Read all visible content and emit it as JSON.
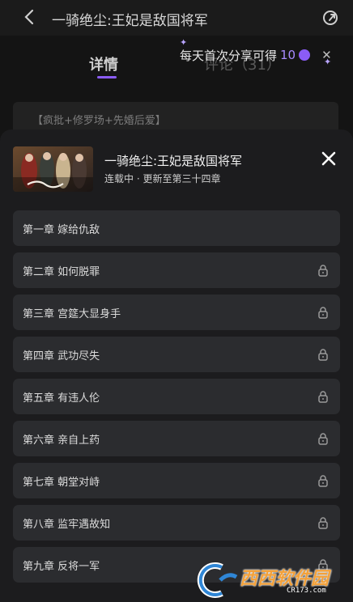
{
  "header": {
    "title": "一骑绝尘:王妃是敌国将军"
  },
  "tabs": {
    "detail": "详情",
    "other": "评论（31）"
  },
  "promo": {
    "text": "每天首次分享可得",
    "count": "10"
  },
  "tags": "【疯批+修罗场+先婚后爱】",
  "sheet": {
    "book_title": "一骑绝尘:王妃是敌国将军",
    "status": "连载中 · 更新至第三十四章",
    "chapters": [
      {
        "label": "第一章 嫁给仇敌",
        "locked": false
      },
      {
        "label": "第二章 如何脱罪",
        "locked": true
      },
      {
        "label": "第三章 宫筵大显身手",
        "locked": true
      },
      {
        "label": "第四章 武功尽失",
        "locked": true
      },
      {
        "label": "第五章 有违人伦",
        "locked": true
      },
      {
        "label": "第六章 亲自上药",
        "locked": true
      },
      {
        "label": "第七章 朝堂对峙",
        "locked": true
      },
      {
        "label": "第八章 监牢遇故知",
        "locked": true
      },
      {
        "label": "第九章 反将一军",
        "locked": true
      }
    ]
  },
  "watermark": {
    "text": "西西软件园",
    "url": "CR173.com"
  },
  "colors": {
    "accent": "#8b5cf6",
    "sheet_bg": "#1c1c1e",
    "item_bg": "#2b2c2f"
  }
}
